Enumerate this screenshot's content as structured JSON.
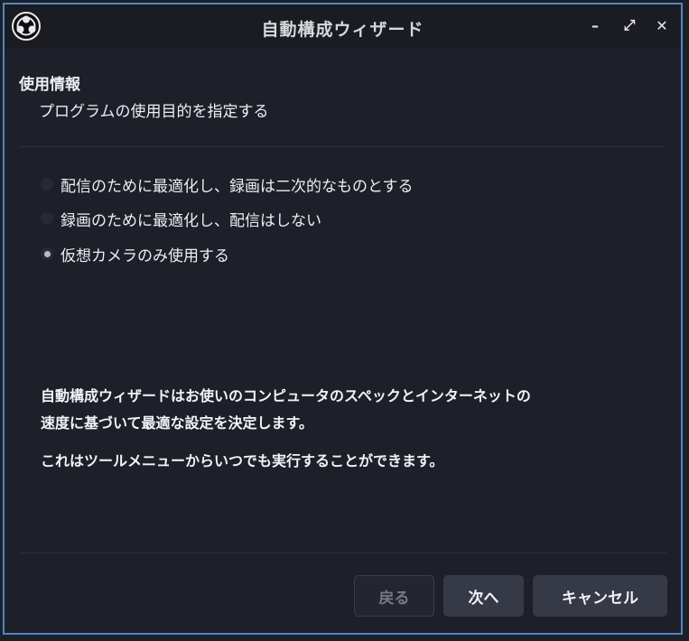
{
  "window": {
    "title": "自動構成ウィザード",
    "accent_color": "#4f86c6"
  },
  "icons": {
    "app": "obs-logo-icon",
    "minimize": "minimize-icon",
    "maximize": "maximize-icon",
    "close": "close-icon"
  },
  "window_controls": {
    "minimize": "–",
    "maximize": "⤢",
    "close": "✕"
  },
  "page": {
    "title": "使用情報",
    "subtitle": "プログラムの使用目的を指定する"
  },
  "options": [
    {
      "label": "配信のために最適化し、録画は二次的なものとする",
      "selected": false
    },
    {
      "label": "録画のために最適化し、配信はしない",
      "selected": false
    },
    {
      "label": "仮想カメラのみ使用する",
      "selected": true
    }
  ],
  "info": {
    "line1": "自動構成ウィザードはお使いのコンピュータのスペックとインターネットの",
    "line2": "速度に基づいて最適な設定を決定します。",
    "line3": "これはツールメニューからいつでも実行することができます。"
  },
  "buttons": {
    "back": "戻る",
    "next": "次へ",
    "cancel": "キャンセル"
  }
}
